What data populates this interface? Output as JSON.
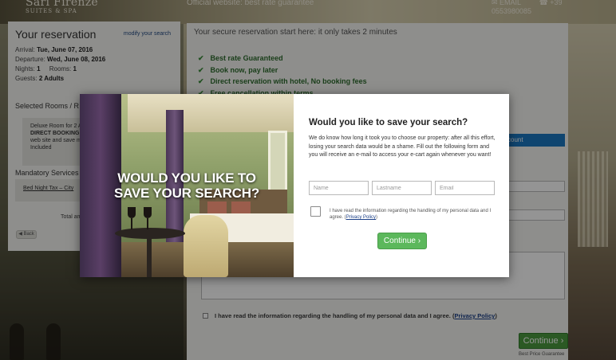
{
  "header": {
    "logo_line1": "Sari Firenze",
    "logo_line2": "SUITES & SPA",
    "official": "Official website: best rate guarantee",
    "email": "EMAIL",
    "phone": "+39 0553980085"
  },
  "reservation": {
    "title": "Your reservation",
    "modify": "modify your search",
    "arrival_label": "Arrival:",
    "arrival": "Tue, June 07, 2016",
    "departure_label": "Departure:",
    "departure": "Wed, June 08, 2016",
    "nights_label": "Nights:",
    "nights": "1",
    "rooms_label": "Rooms:",
    "rooms": "1",
    "guests_label": "Guests:",
    "guests": "2 Adults",
    "selected_rooms": "Selected Rooms / R",
    "room_line1": "Deluxe Room for 2 Ad",
    "room_line2": "DIRECT BOOKING -",
    "room_line3": "web site and save m",
    "room_line4": "Included",
    "mandatory_title": "Mandatory Services",
    "mandatory_item": "Bed Night Tax – City",
    "total_label": "Total amo",
    "back": "Back"
  },
  "main": {
    "heading": "Your secure reservation start here: it only takes 2 minutes",
    "benefits": [
      "Best rate Guaranteed",
      "Book now, pay later",
      "Direct reservation with hotel, No booking fees",
      "Free cancellation within terms"
    ],
    "account_button": "ccount",
    "privacy_text": "I have read the information regarding the handling of my personal data and I agree. (",
    "privacy_link": "Privacy Policy",
    "privacy_close": ")",
    "continue": "Continue",
    "best_price": "Best Price Guarantee"
  },
  "modal": {
    "photo_line1": "WOULD YOU LIKE TO",
    "photo_line2": "SAVE YOUR SEARCH?",
    "title": "Would you like to save your search?",
    "description": "We do know how long it took you to choose our property: after all this effort, losing your search data would be a shame. Fill out the following form and you will receive an e-mail to access your e-cart again whenever you want!",
    "name_placeholder": "Name",
    "lastname_placeholder": "Lastname",
    "email_placeholder": "Email",
    "agree_text": "I have read the information regarding the handling of my personal data and I agree. (",
    "agree_link": "Privacy Policy",
    "agree_close": ")",
    "continue": "Continue"
  }
}
